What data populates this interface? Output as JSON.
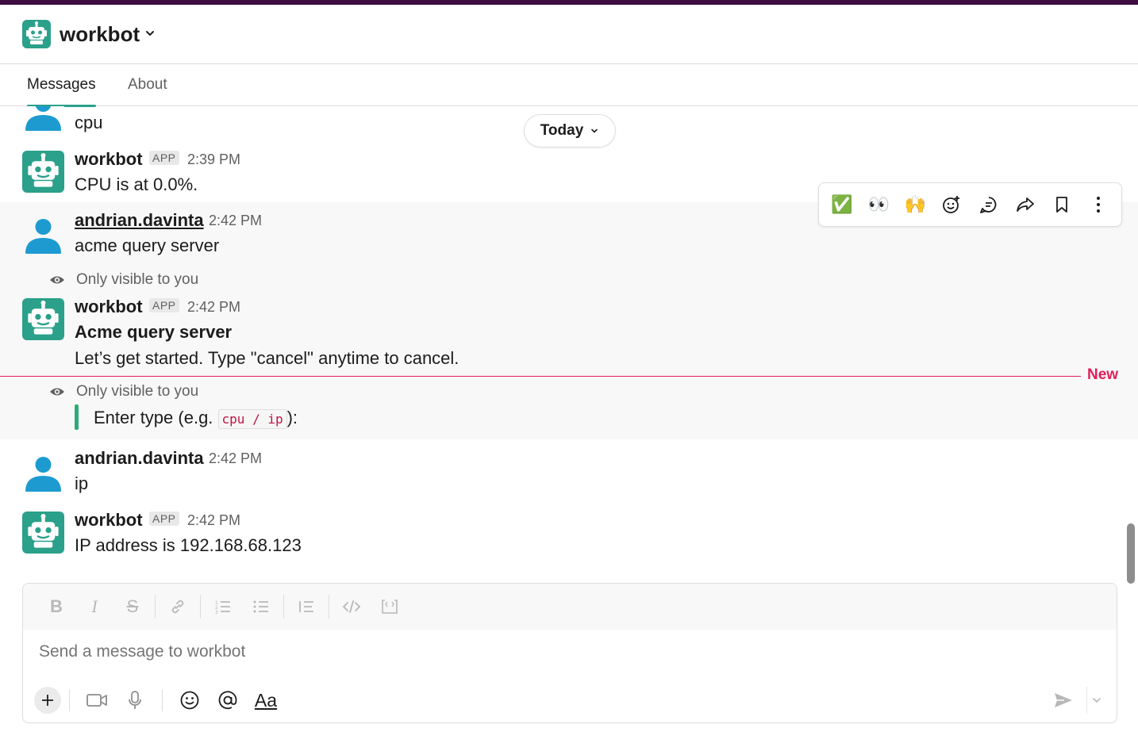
{
  "app": {
    "name": "workbot"
  },
  "tabs": [
    {
      "label": "Messages"
    },
    {
      "label": "About"
    }
  ],
  "date_divider": {
    "label": "Today"
  },
  "messages": [
    {
      "text": "cpu"
    },
    {
      "sender": "workbot",
      "badge": "APP",
      "time": "2:39 PM",
      "text": "CPU is at 0.0%."
    },
    {
      "sender": "andrian.davinta",
      "time": "2:42 PM",
      "text": "acme query server"
    },
    {
      "ephemeral": "Only visible to you",
      "sender": "workbot",
      "badge": "APP",
      "time": "2:42 PM",
      "title": "Acme query server",
      "text": "Let’s get started. Type \"cancel\" anytime to cancel."
    },
    {
      "ephemeral": "Only visible to you",
      "text_before": "Enter type (e.g. ",
      "code": "cpu / ip",
      "text_after": "):"
    },
    {
      "sender": "andrian.davinta",
      "time": "2:42 PM",
      "text": "ip"
    },
    {
      "sender": "workbot",
      "badge": "APP",
      "time": "2:42 PM",
      "text": "IP address is 192.168.68.123"
    }
  ],
  "new_divider": {
    "label": "New"
  },
  "message_actions": [
    "✅",
    "👀",
    "🙌",
    "add-reaction-icon",
    "reply-in-thread-icon",
    "share-icon",
    "bookmark-icon",
    "more-icon"
  ],
  "composer": {
    "placeholder": "Send a message to workbot",
    "format_label": "Aa"
  },
  "colors": {
    "accent": "#2ba08a",
    "new_divider": "#e01e5a",
    "code": "#c01343",
    "quote_bar": "#2bac76",
    "user_avatar": "#1d9bd1",
    "bot_avatar": "#2ba08a"
  }
}
